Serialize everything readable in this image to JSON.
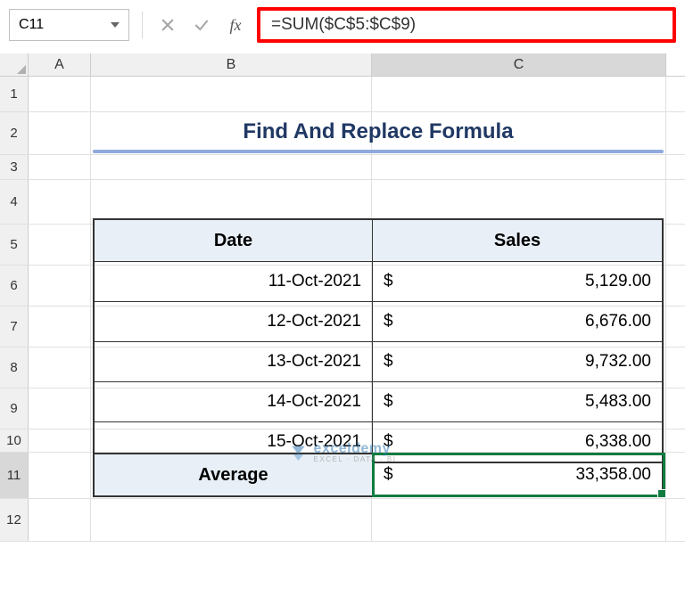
{
  "nameBox": "C11",
  "formula": "=SUM($C$5:$C$9)",
  "columns": {
    "A": "A",
    "B": "B",
    "C": "C"
  },
  "rows": [
    "1",
    "2",
    "3",
    "4",
    "5",
    "6",
    "7",
    "8",
    "9",
    "10",
    "11",
    "12"
  ],
  "title": "Find And Replace Formula",
  "headers": {
    "date": "Date",
    "sales": "Sales"
  },
  "currency": "$",
  "data": [
    {
      "date": "11-Oct-2021",
      "sales": "5,129.00"
    },
    {
      "date": "12-Oct-2021",
      "sales": "6,676.00"
    },
    {
      "date": "13-Oct-2021",
      "sales": "9,732.00"
    },
    {
      "date": "14-Oct-2021",
      "sales": "5,483.00"
    },
    {
      "date": "15-Oct-2021",
      "sales": "6,338.00"
    }
  ],
  "avg": {
    "label": "Average",
    "value": "33,358.00"
  },
  "watermark": {
    "main": "exceldemy",
    "sub": "EXCEL · DATA · BI"
  },
  "activeCell": "C11"
}
